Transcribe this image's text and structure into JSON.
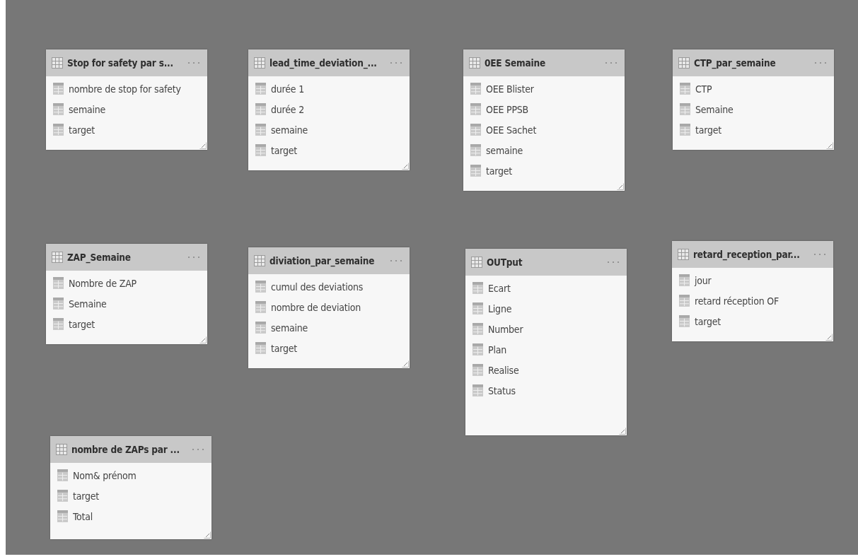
{
  "tables": [
    {
      "title": "Stop for safety par s...",
      "fields": [
        "nombre de stop for safety",
        "semaine",
        "target"
      ]
    },
    {
      "title": "lead_time_deviation_...",
      "fields": [
        "durée 1",
        "durée 2",
        "semaine",
        "target"
      ]
    },
    {
      "title": "0EE Semaine",
      "fields": [
        "OEE Blister",
        "OEE PPSB",
        "OEE Sachet",
        "semaine",
        "target"
      ]
    },
    {
      "title": "CTP_par_semaine",
      "fields": [
        "CTP",
        "Semaine",
        "target"
      ]
    },
    {
      "title": "ZAP_Semaine",
      "fields": [
        "Nombre de ZAP",
        "Semaine",
        "target"
      ]
    },
    {
      "title": "diviation_par_semaine",
      "fields": [
        "cumul des deviations",
        "nombre de deviation",
        "semaine",
        "target"
      ]
    },
    {
      "title": "OUTput",
      "fields": [
        "Ecart",
        "Ligne",
        "Number",
        "Plan",
        "Realise",
        "Status"
      ]
    },
    {
      "title": "retard_reception_par...",
      "fields": [
        "jour",
        "retard réception OF",
        "target"
      ]
    },
    {
      "title": "nombre de ZAPs par ...",
      "fields": [
        "Nom& prénom",
        "target",
        "Total"
      ]
    }
  ]
}
